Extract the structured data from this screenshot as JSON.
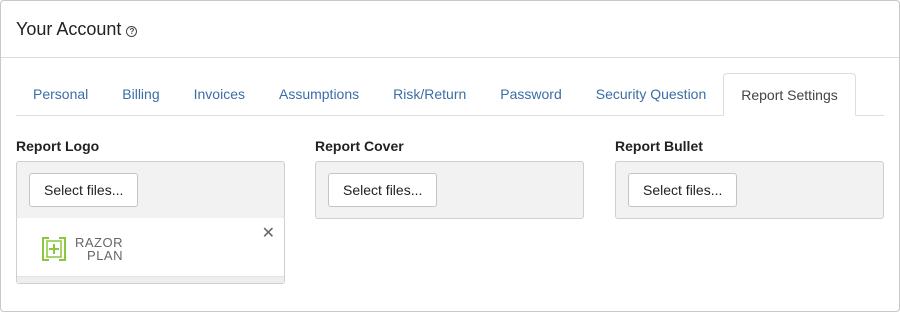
{
  "header": {
    "title": "Your Account",
    "help_icon": "question-circle-icon",
    "help_glyph": "?"
  },
  "tabs": [
    {
      "label": "Personal"
    },
    {
      "label": "Billing"
    },
    {
      "label": "Invoices"
    },
    {
      "label": "Assumptions"
    },
    {
      "label": "Risk/Return"
    },
    {
      "label": "Password"
    },
    {
      "label": "Security Question"
    },
    {
      "label": "Report Settings",
      "active": true
    }
  ],
  "uploads": [
    {
      "label": "Report Logo",
      "button": "Select files...",
      "file": {
        "logo_line1": "RAZOR",
        "logo_line2": "PLAN",
        "remove_glyph": "✕"
      }
    },
    {
      "label": "Report Cover",
      "button": "Select files..."
    },
    {
      "label": "Report Bullet",
      "button": "Select files..."
    }
  ],
  "colors": {
    "link": "#3a6ea5",
    "logo_green": "#8cc63f"
  }
}
